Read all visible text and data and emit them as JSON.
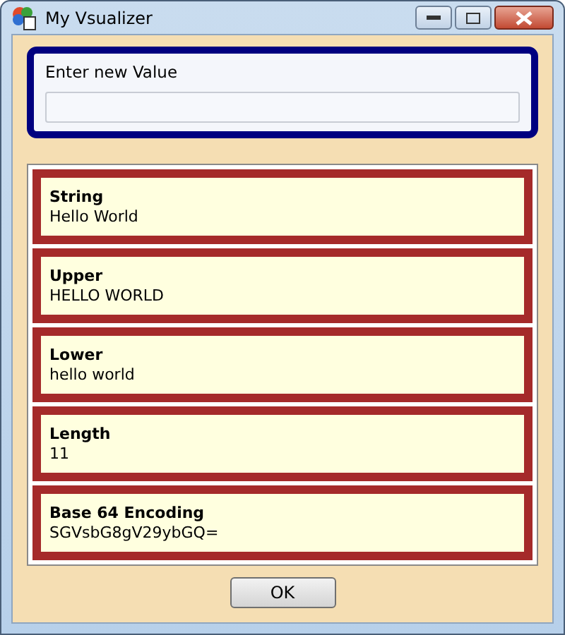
{
  "window": {
    "title": "My Vsualizer"
  },
  "input": {
    "label": "Enter new Value"
  },
  "results": [
    {
      "name": "String",
      "value": "Hello World"
    },
    {
      "name": "Upper",
      "value": "HELLO WORLD"
    },
    {
      "name": "Lower",
      "value": "hello world"
    },
    {
      "name": "Length",
      "value": "11"
    },
    {
      "name": "Base 64 Encoding",
      "value": "SGVsbG8gV29ybGQ="
    }
  ],
  "buttons": [
    "OK"
  ]
}
